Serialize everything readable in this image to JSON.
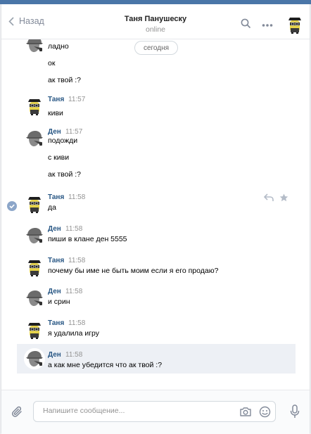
{
  "header": {
    "back_label": "Назад",
    "title": "Таня Панушеску",
    "status": "online"
  },
  "day_separator": "сегодня",
  "messages": [
    {
      "author": "",
      "time": "",
      "lines": [
        "ладно",
        "ок",
        "ак твой :?"
      ]
    },
    {
      "author": "Таня",
      "time": "11:57",
      "lines": [
        "киви"
      ]
    },
    {
      "author": "Ден",
      "time": "11:57",
      "lines": [
        "подожди",
        "с киви",
        "ак твой :?"
      ]
    },
    {
      "author": "Таня",
      "time": "11:58",
      "lines": [
        "да"
      ]
    },
    {
      "author": "Ден",
      "time": "11:58",
      "lines": [
        "пиши в клане ден 5555"
      ]
    },
    {
      "author": "Таня",
      "time": "11:58",
      "lines": [
        "почему бы име не быть моим если я его продаю?"
      ]
    },
    {
      "author": "Ден",
      "time": "11:58",
      "lines": [
        "и срин"
      ]
    },
    {
      "author": "Таня",
      "time": "11:58",
      "lines": [
        "я удалила игру"
      ]
    },
    {
      "author": "Ден",
      "time": "11:58",
      "lines": [
        "а как мне убедится что ак твой :?"
      ]
    }
  ],
  "composer": {
    "placeholder": "Напишите сообщение..."
  },
  "icons": {
    "back": "chevron-left-icon",
    "search": "search-icon",
    "more": "more-icon",
    "attach": "paperclip-icon",
    "camera": "camera-icon",
    "emoji": "smile-icon",
    "voice": "microphone-icon",
    "reply": "reply-icon",
    "favorite": "star-icon",
    "selected": "check-icon"
  },
  "colors": {
    "accent": "#4a76a8",
    "author_name": "#2a5885",
    "highlight": "#edf0f5",
    "muted": "#939393"
  }
}
